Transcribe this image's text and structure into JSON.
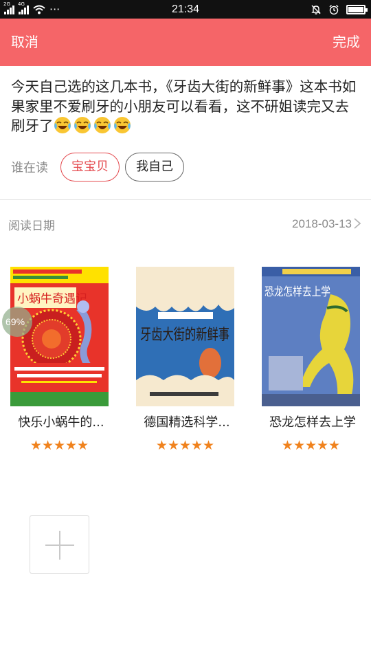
{
  "status_bar": {
    "time": "21:34",
    "network_1": "2G",
    "network_2": "4G",
    "dots": "···"
  },
  "header": {
    "cancel_label": "取消",
    "done_label": "完成",
    "background_color": "#f56568"
  },
  "note": {
    "text": "今天自己选的这几本书，《牙齿大街的新鲜事》这本书如果家里不爱刷牙的小朋友可以看看，这不研姐读完又去刷牙了",
    "emoji_count": 4,
    "emoji_icon": "face-with-tears-of-joy"
  },
  "readers": {
    "label": "谁在读",
    "options": [
      {
        "label": "宝宝贝",
        "selected": true
      },
      {
        "label": "我自己",
        "selected": false
      }
    ]
  },
  "reading_date": {
    "label": "阅读日期",
    "value": "2018-03-13"
  },
  "books": [
    {
      "title": "快乐小蜗牛的...",
      "rating": 5,
      "cover_title": "小蜗牛奇遇记",
      "cover_color": "#e8332a"
    },
    {
      "title": "德国精选科学...",
      "rating": 5,
      "cover_title": "牙齿大街的新鲜事",
      "cover_color": "#2f6fb6"
    },
    {
      "title": "恐龙怎样去上学",
      "rating": 5,
      "cover_title": "恐龙怎样去上学",
      "cover_color": "#5d7fc2"
    }
  ],
  "stars_text": "★★★★★",
  "progress_badge": {
    "value": "69%"
  },
  "add_button": {
    "icon": "plus-icon"
  },
  "colors": {
    "accent": "#f56568",
    "selected_chip": "#e44a4f",
    "star": "#f0821d"
  }
}
